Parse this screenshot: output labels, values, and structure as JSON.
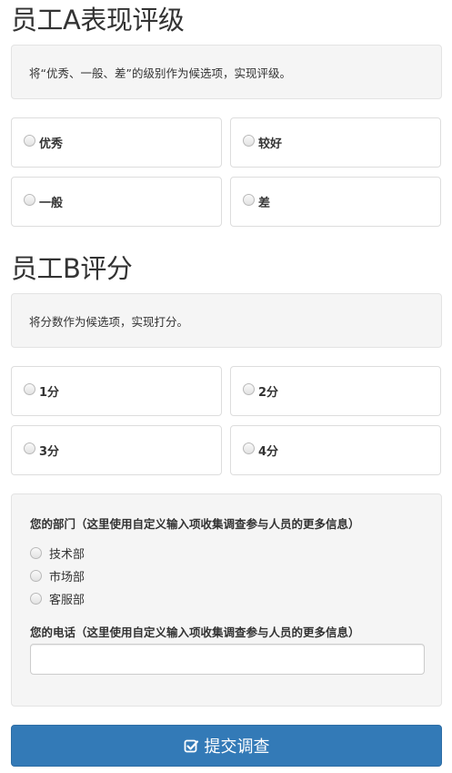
{
  "section_a": {
    "title": "员工A表现评级",
    "description": "将“优秀、一般、差”的级别作为候选项，实现评级。",
    "options": [
      {
        "label": "优秀"
      },
      {
        "label": "较好"
      },
      {
        "label": "一般"
      },
      {
        "label": "差"
      }
    ]
  },
  "section_b": {
    "title": "员工B评分",
    "description": "将分数作为候选项，实现打分。",
    "options": [
      {
        "label": "1分"
      },
      {
        "label": "2分"
      },
      {
        "label": "3分"
      },
      {
        "label": "4分"
      }
    ]
  },
  "custom_fields": {
    "department": {
      "label": "您的部门（这里使用自定义输入项收集调查参与人员的更多信息）",
      "options": [
        {
          "label": "技术部"
        },
        {
          "label": "市场部"
        },
        {
          "label": "客服部"
        }
      ]
    },
    "phone": {
      "label": "您的电话（这里使用自定义输入项收集调查参与人员的更多信息）",
      "value": "",
      "placeholder": ""
    }
  },
  "submit": {
    "label": "提交调查",
    "icon": "check-square-icon",
    "color": "#337ab7"
  }
}
